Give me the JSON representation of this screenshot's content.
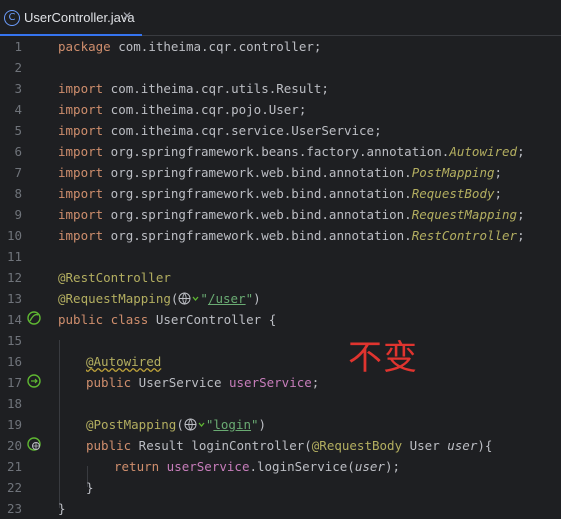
{
  "tab": {
    "icon": "java-class-icon",
    "label": "UserController.java",
    "close": "✕"
  },
  "overlay_text": "不变",
  "lines": [
    {
      "n": "1"
    },
    {
      "n": "2"
    },
    {
      "n": "3"
    },
    {
      "n": "4"
    },
    {
      "n": "5"
    },
    {
      "n": "6"
    },
    {
      "n": "7"
    },
    {
      "n": "8"
    },
    {
      "n": "9"
    },
    {
      "n": "10"
    },
    {
      "n": "11"
    },
    {
      "n": "12"
    },
    {
      "n": "13"
    },
    {
      "n": "14"
    },
    {
      "n": "15"
    },
    {
      "n": "16"
    },
    {
      "n": "17"
    },
    {
      "n": "18"
    },
    {
      "n": "19"
    },
    {
      "n": "20"
    },
    {
      "n": "21"
    },
    {
      "n": "22"
    },
    {
      "n": "23"
    }
  ],
  "code": {
    "l1": {
      "kw": "package",
      "rest": " com.itheima.cqr.controller;"
    },
    "l3": {
      "kw": "import",
      "rest": " com.itheima.cqr.utils.Result;"
    },
    "l4": {
      "kw": "import",
      "rest": " com.itheima.cqr.pojo.User;"
    },
    "l5": {
      "kw": "import",
      "rest": " com.itheima.cqr.service.UserService;"
    },
    "l6": {
      "kw": "import",
      "pkg": " org.springframework.beans.factory.annotation.",
      "cls": "Autowired",
      "end": ";"
    },
    "l7": {
      "kw": "import",
      "pkg": " org.springframework.web.bind.annotation.",
      "cls": "PostMapping",
      "end": ";"
    },
    "l8": {
      "kw": "import",
      "pkg": " org.springframework.web.bind.annotation.",
      "cls": "RequestBody",
      "end": ";"
    },
    "l9": {
      "kw": "import",
      "pkg": " org.springframework.web.bind.annotation.",
      "cls": "RequestMapping",
      "end": ";"
    },
    "l10": {
      "kw": "import",
      "pkg": " org.springframework.web.bind.annotation.",
      "cls": "RestController",
      "end": ";"
    },
    "l12": {
      "ann": "@RestController"
    },
    "l13": {
      "ann": "@RequestMapping",
      "open": "(",
      "q1": "\"",
      "path": "/user",
      "q2": "\"",
      "close": ")"
    },
    "l14": {
      "kw": "public class",
      "name": " UserController ",
      "brace": "{"
    },
    "l16": {
      "ann": "@Autowired"
    },
    "l17": {
      "kw": "public",
      "type": " UserService ",
      "field": "userService",
      "end": ";"
    },
    "l19": {
      "ann": "@PostMapping",
      "open": "(",
      "q1": "\"",
      "path": "login",
      "q2": "\"",
      "close": ")"
    },
    "l20": {
      "kw": "public",
      "type": " Result loginController(",
      "ann": "@RequestBody",
      "ptype": " User ",
      "param": "user",
      "end": "){"
    },
    "l21": {
      "kw": "return",
      "field": " userService",
      "call": ".loginService(",
      "param": "user",
      "end": ");"
    },
    "l22": {
      "brace": "}"
    },
    "l23": {
      "brace": "}"
    }
  }
}
